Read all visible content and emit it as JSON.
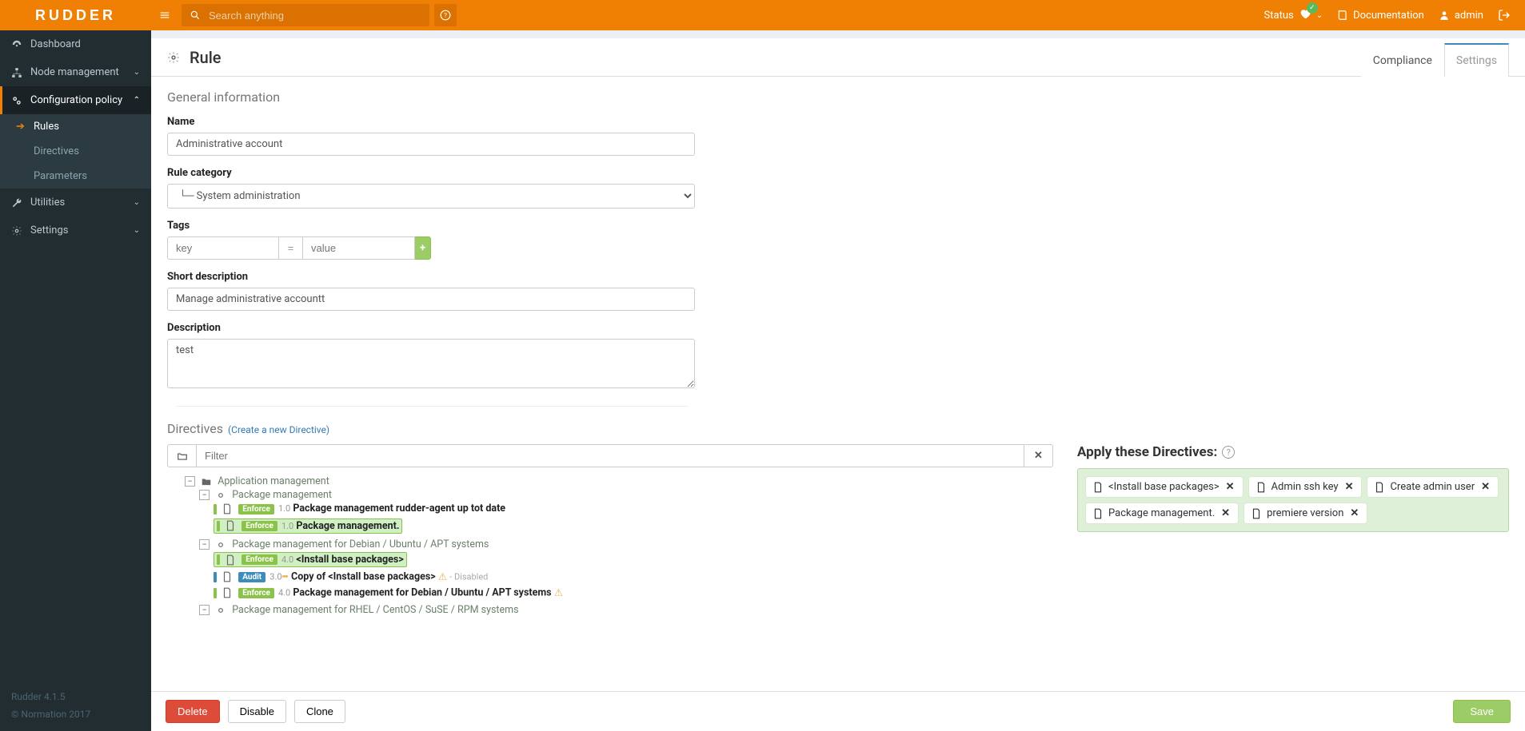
{
  "brand": "RUDDER",
  "topbar": {
    "search_placeholder": "Search anything",
    "status_label": "Status",
    "documentation_label": "Documentation",
    "user_label": "admin"
  },
  "sidebar": {
    "items": [
      {
        "label": "Dashboard"
      },
      {
        "label": "Node management"
      },
      {
        "label": "Configuration policy"
      },
      {
        "label": "Utilities"
      },
      {
        "label": "Settings"
      }
    ],
    "config_children": [
      {
        "label": "Rules"
      },
      {
        "label": "Directives"
      },
      {
        "label": "Parameters"
      }
    ],
    "footer_version": "Rudder 4.1.5",
    "footer_copyright": "© Normation 2017"
  },
  "page": {
    "title": "Rule",
    "tabs": {
      "compliance": "Compliance",
      "settings": "Settings"
    }
  },
  "form": {
    "section_general": "General information",
    "name_label": "Name",
    "name_value": "Administrative account",
    "category_label": "Rule category",
    "category_value": "└─ System administration",
    "tags_label": "Tags",
    "tag_key_placeholder": "key",
    "tag_eq": "=",
    "tag_val_placeholder": "value",
    "short_label": "Short description",
    "short_value": "Manage administrative accountt",
    "desc_label": "Description",
    "desc_value": "test"
  },
  "directives": {
    "section_label": "Directives",
    "create_link": "(Create a new Directive)",
    "filter_placeholder": "Filter",
    "applied_title": "Apply these Directives:",
    "enforce_text": "Enforce",
    "audit_text": "Audit",
    "disabled_text": " - Disabled",
    "tree": {
      "cat_app": "Application management",
      "grp_pkg": "Package management",
      "leaf_rudder_agent": {
        "ver": "1.0",
        "label": "Package management rudder-agent up tot date"
      },
      "leaf_pkg_mgmt": {
        "ver": "1.0",
        "label": "Package management."
      },
      "grp_apt": "Package management for Debian / Ubuntu / APT systems",
      "leaf_install_base": {
        "ver": "4.0",
        "label": "<Install base packages>"
      },
      "leaf_copy_install": {
        "ver": "3.0",
        "label": "Copy of <Install base packages>"
      },
      "leaf_apt_full": {
        "ver": "4.0",
        "label": "Package management for Debian / Ubuntu / APT systems"
      },
      "grp_rhel": "Package management for RHEL / CentOS / SuSE / RPM systems"
    },
    "applied": [
      {
        "label": "<Install base packages>"
      },
      {
        "label": "Admin ssh key"
      },
      {
        "label": "Create admin user"
      },
      {
        "label": "Package management."
      },
      {
        "label": "premiere version"
      }
    ]
  },
  "actions": {
    "delete": "Delete",
    "disable": "Disable",
    "clone": "Clone",
    "save": "Save"
  }
}
